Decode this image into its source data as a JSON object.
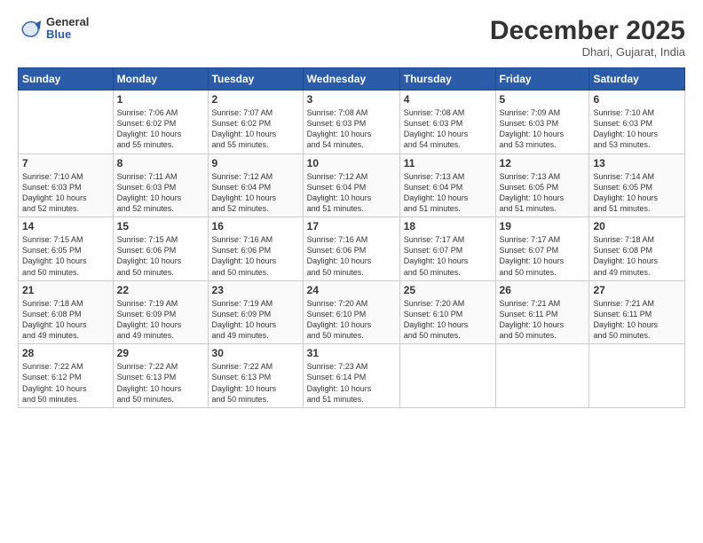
{
  "header": {
    "logo_general": "General",
    "logo_blue": "Blue",
    "month": "December 2025",
    "location": "Dhari, Gujarat, India"
  },
  "days_of_week": [
    "Sunday",
    "Monday",
    "Tuesday",
    "Wednesday",
    "Thursday",
    "Friday",
    "Saturday"
  ],
  "weeks": [
    [
      {
        "day": "",
        "info": ""
      },
      {
        "day": "1",
        "info": "Sunrise: 7:06 AM\nSunset: 6:02 PM\nDaylight: 10 hours\nand 55 minutes."
      },
      {
        "day": "2",
        "info": "Sunrise: 7:07 AM\nSunset: 6:02 PM\nDaylight: 10 hours\nand 55 minutes."
      },
      {
        "day": "3",
        "info": "Sunrise: 7:08 AM\nSunset: 6:03 PM\nDaylight: 10 hours\nand 54 minutes."
      },
      {
        "day": "4",
        "info": "Sunrise: 7:08 AM\nSunset: 6:03 PM\nDaylight: 10 hours\nand 54 minutes."
      },
      {
        "day": "5",
        "info": "Sunrise: 7:09 AM\nSunset: 6:03 PM\nDaylight: 10 hours\nand 53 minutes."
      },
      {
        "day": "6",
        "info": "Sunrise: 7:10 AM\nSunset: 6:03 PM\nDaylight: 10 hours\nand 53 minutes."
      }
    ],
    [
      {
        "day": "7",
        "info": "Sunrise: 7:10 AM\nSunset: 6:03 PM\nDaylight: 10 hours\nand 52 minutes."
      },
      {
        "day": "8",
        "info": "Sunrise: 7:11 AM\nSunset: 6:03 PM\nDaylight: 10 hours\nand 52 minutes."
      },
      {
        "day": "9",
        "info": "Sunrise: 7:12 AM\nSunset: 6:04 PM\nDaylight: 10 hours\nand 52 minutes."
      },
      {
        "day": "10",
        "info": "Sunrise: 7:12 AM\nSunset: 6:04 PM\nDaylight: 10 hours\nand 51 minutes."
      },
      {
        "day": "11",
        "info": "Sunrise: 7:13 AM\nSunset: 6:04 PM\nDaylight: 10 hours\nand 51 minutes."
      },
      {
        "day": "12",
        "info": "Sunrise: 7:13 AM\nSunset: 6:05 PM\nDaylight: 10 hours\nand 51 minutes."
      },
      {
        "day": "13",
        "info": "Sunrise: 7:14 AM\nSunset: 6:05 PM\nDaylight: 10 hours\nand 51 minutes."
      }
    ],
    [
      {
        "day": "14",
        "info": "Sunrise: 7:15 AM\nSunset: 6:05 PM\nDaylight: 10 hours\nand 50 minutes."
      },
      {
        "day": "15",
        "info": "Sunrise: 7:15 AM\nSunset: 6:06 PM\nDaylight: 10 hours\nand 50 minutes."
      },
      {
        "day": "16",
        "info": "Sunrise: 7:16 AM\nSunset: 6:06 PM\nDaylight: 10 hours\nand 50 minutes."
      },
      {
        "day": "17",
        "info": "Sunrise: 7:16 AM\nSunset: 6:06 PM\nDaylight: 10 hours\nand 50 minutes."
      },
      {
        "day": "18",
        "info": "Sunrise: 7:17 AM\nSunset: 6:07 PM\nDaylight: 10 hours\nand 50 minutes."
      },
      {
        "day": "19",
        "info": "Sunrise: 7:17 AM\nSunset: 6:07 PM\nDaylight: 10 hours\nand 50 minutes."
      },
      {
        "day": "20",
        "info": "Sunrise: 7:18 AM\nSunset: 6:08 PM\nDaylight: 10 hours\nand 49 minutes."
      }
    ],
    [
      {
        "day": "21",
        "info": "Sunrise: 7:18 AM\nSunset: 6:08 PM\nDaylight: 10 hours\nand 49 minutes."
      },
      {
        "day": "22",
        "info": "Sunrise: 7:19 AM\nSunset: 6:09 PM\nDaylight: 10 hours\nand 49 minutes."
      },
      {
        "day": "23",
        "info": "Sunrise: 7:19 AM\nSunset: 6:09 PM\nDaylight: 10 hours\nand 49 minutes."
      },
      {
        "day": "24",
        "info": "Sunrise: 7:20 AM\nSunset: 6:10 PM\nDaylight: 10 hours\nand 50 minutes."
      },
      {
        "day": "25",
        "info": "Sunrise: 7:20 AM\nSunset: 6:10 PM\nDaylight: 10 hours\nand 50 minutes."
      },
      {
        "day": "26",
        "info": "Sunrise: 7:21 AM\nSunset: 6:11 PM\nDaylight: 10 hours\nand 50 minutes."
      },
      {
        "day": "27",
        "info": "Sunrise: 7:21 AM\nSunset: 6:11 PM\nDaylight: 10 hours\nand 50 minutes."
      }
    ],
    [
      {
        "day": "28",
        "info": "Sunrise: 7:22 AM\nSunset: 6:12 PM\nDaylight: 10 hours\nand 50 minutes."
      },
      {
        "day": "29",
        "info": "Sunrise: 7:22 AM\nSunset: 6:13 PM\nDaylight: 10 hours\nand 50 minutes."
      },
      {
        "day": "30",
        "info": "Sunrise: 7:22 AM\nSunset: 6:13 PM\nDaylight: 10 hours\nand 50 minutes."
      },
      {
        "day": "31",
        "info": "Sunrise: 7:23 AM\nSunset: 6:14 PM\nDaylight: 10 hours\nand 51 minutes."
      },
      {
        "day": "",
        "info": ""
      },
      {
        "day": "",
        "info": ""
      },
      {
        "day": "",
        "info": ""
      }
    ]
  ]
}
